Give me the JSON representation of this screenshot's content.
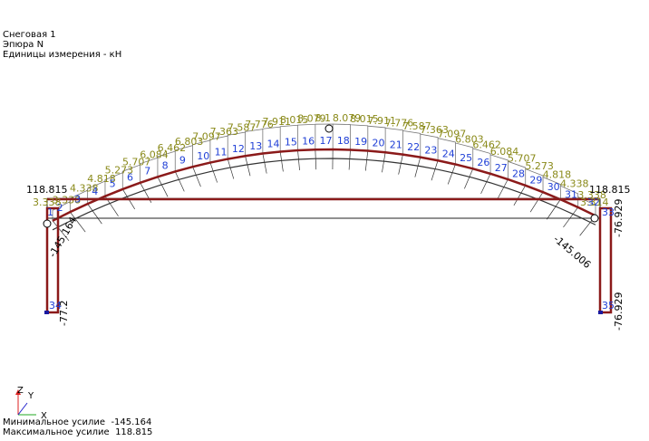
{
  "header": {
    "load_case": "Снеговая 1",
    "diagram": "Эпюра  N",
    "units": "Единицы измерения - кН"
  },
  "footer": {
    "min_label": "Минимальное усилие",
    "min_value": "-145.164",
    "max_label": "Максимальное усилие",
    "max_value": "118.815"
  },
  "axes": {
    "z": "Z",
    "y": "Y",
    "x": "X"
  },
  "colors": {
    "member": "#8b1a1a",
    "node_label": "#1f3fd6",
    "arch_value": "#8a8a1a",
    "text": "#000000",
    "support": "#1a1aa0"
  },
  "diagram": {
    "arch_node_labels": [
      "2",
      "3",
      "4",
      "5",
      "6",
      "7",
      "8",
      "9",
      "10",
      "11",
      "12",
      "13",
      "14",
      "15",
      "16",
      "17",
      "18",
      "19",
      "20",
      "21",
      "22",
      "23",
      "24",
      "25",
      "26",
      "27",
      "28",
      "29",
      "30",
      "31"
    ],
    "arch_values": [
      "3.338",
      "4.338",
      "4.818",
      "5.273",
      "5.707",
      "6.084",
      "6.462",
      "6.803",
      "7.097",
      "7.363",
      "7.587",
      "7.776",
      "7.911",
      "8.015",
      "8.079",
      "8.1",
      "8.079",
      "8.015",
      "7.911",
      "7.776",
      "7.587",
      "7.363",
      "7.097",
      "6.803",
      "6.462",
      "6.084",
      "5.707",
      "5.273",
      "4.818",
      "4.338",
      "3.338"
    ],
    "end_nodes": [
      "1",
      "32",
      "33",
      "34",
      "35"
    ],
    "tie_left_value": "118.815",
    "tie_right_value": "118.815",
    "left_column_value": "-77.2",
    "right_column_value_top": "-76.929",
    "right_column_value_bottom": "-76.929",
    "left_small_value": "3.338",
    "right_small_value": "3.314",
    "arch_left_value": "-145.164",
    "arch_right_value": "-145.006"
  }
}
